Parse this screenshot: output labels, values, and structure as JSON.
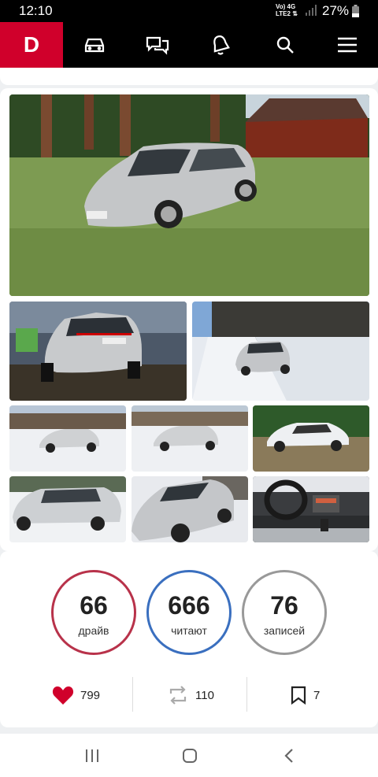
{
  "status": {
    "time": "12:10",
    "network": "Vo) 4G\nLTE2",
    "battery": "27%"
  },
  "appbar": {
    "logo": "D"
  },
  "stats": [
    {
      "value": "66",
      "label": "драйв",
      "color": "#b8324a"
    },
    {
      "value": "666",
      "label": "читают",
      "color": "#3a6fbf"
    },
    {
      "value": "76",
      "label": "записей",
      "color": "#999999"
    }
  ],
  "actions": {
    "likes": "799",
    "reposts": "110",
    "bookmarks": "7"
  }
}
